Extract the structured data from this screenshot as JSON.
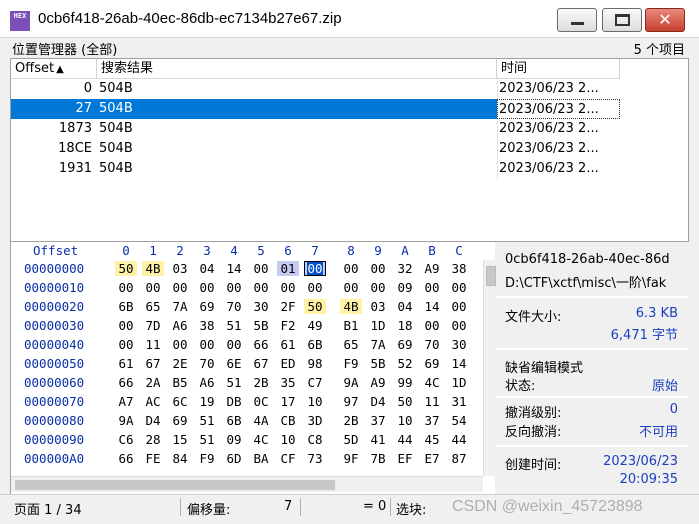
{
  "window": {
    "title": "0cb6f418-26ab-40ec-86db-ec7134b27e67.zip",
    "icon_name": "hex-editor-icon",
    "icon_text": "HEX"
  },
  "location_manager": {
    "title": "位置管理器 (全部)",
    "count": "5 个项目",
    "columns": [
      "Offset",
      "搜索结果",
      "时间"
    ],
    "rows": [
      {
        "offset": "0",
        "result": "504B",
        "time": "2023/06/23   2..."
      },
      {
        "offset": "27",
        "result": "504B",
        "time": "2023/06/23   2...",
        "selected": true
      },
      {
        "offset": "1873",
        "result": "504B",
        "time": "2023/06/23   2..."
      },
      {
        "offset": "18CE",
        "result": "504B",
        "time": "2023/06/23   2..."
      },
      {
        "offset": "1931",
        "result": "504B",
        "time": "2023/06/23   2..."
      }
    ]
  },
  "hex": {
    "offset_label": "Offset",
    "columns": [
      "0",
      "1",
      "2",
      "3",
      "4",
      "5",
      "6",
      "7",
      "8",
      "9",
      "A",
      "B",
      "C"
    ],
    "rows": [
      {
        "offset": "00000000",
        "bytes": [
          "50",
          "4B",
          "03",
          "04",
          "14",
          "00",
          "01",
          "00",
          "00",
          "00",
          "32",
          "A9",
          "38"
        ]
      },
      {
        "offset": "00000010",
        "bytes": [
          "00",
          "00",
          "00",
          "00",
          "00",
          "00",
          "00",
          "00",
          "00",
          "00",
          "09",
          "00",
          "00"
        ]
      },
      {
        "offset": "00000020",
        "bytes": [
          "6B",
          "65",
          "7A",
          "69",
          "70",
          "30",
          "2F",
          "50",
          "4B",
          "03",
          "04",
          "14",
          "00"
        ]
      },
      {
        "offset": "00000030",
        "bytes": [
          "00",
          "7D",
          "A6",
          "38",
          "51",
          "5B",
          "F2",
          "49",
          "B1",
          "1D",
          "18",
          "00",
          "00"
        ]
      },
      {
        "offset": "00000040",
        "bytes": [
          "00",
          "11",
          "00",
          "00",
          "00",
          "66",
          "61",
          "6B",
          "65",
          "7A",
          "69",
          "70",
          "30"
        ]
      },
      {
        "offset": "00000050",
        "bytes": [
          "61",
          "67",
          "2E",
          "70",
          "6E",
          "67",
          "ED",
          "98",
          "F9",
          "5B",
          "52",
          "69",
          "14"
        ]
      },
      {
        "offset": "00000060",
        "bytes": [
          "66",
          "2A",
          "B5",
          "A6",
          "51",
          "2B",
          "35",
          "C7",
          "9A",
          "A9",
          "99",
          "4C",
          "1D"
        ]
      },
      {
        "offset": "00000070",
        "bytes": [
          "A7",
          "AC",
          "6C",
          "19",
          "DB",
          "0C",
          "17",
          "10",
          "97",
          "D4",
          "50",
          "11",
          "31"
        ]
      },
      {
        "offset": "00000080",
        "bytes": [
          "9A",
          "D4",
          "69",
          "51",
          "6B",
          "4A",
          "CB",
          "3D",
          "2B",
          "37",
          "10",
          "37",
          "54"
        ]
      },
      {
        "offset": "00000090",
        "bytes": [
          "C6",
          "28",
          "15",
          "51",
          "09",
          "4C",
          "10",
          "C8",
          "5D",
          "41",
          "44",
          "45",
          "44"
        ]
      },
      {
        "offset": "000000A0",
        "bytes": [
          "66",
          "FE",
          "84",
          "F9",
          "6D",
          "BA",
          "CF",
          "73",
          "9F",
          "7B",
          "EF",
          "E7",
          "87"
        ]
      }
    ]
  },
  "info_panel": {
    "file_name": "0cb6f418-26ab-40ec-86d",
    "file_path": "D:\\CTF\\xctf\\misc\\一阶\\fak",
    "size_label": "文件大小:",
    "size_kb": "6.3 KB",
    "size_bytes": "6,471 字节",
    "mode_title": "缺省编辑模式",
    "state_label": "状态:",
    "state_value": "原始",
    "undo_label": "撤消级别:",
    "undo_value": "0",
    "redo_label": "反向撤消:",
    "redo_value": "不可用",
    "created_label": "创建时间:",
    "created_date": "2023/06/23",
    "created_time": "20:09:35"
  },
  "status_bar": {
    "page": "页面 1 / 34",
    "offset_label": "偏移量:",
    "offset_value": "7",
    "eq": "= 0",
    "select_label": "选块:",
    "watermark": "CSDN @weixin_45723898"
  },
  "colors": {
    "selection": "#0078d7",
    "hex_header": "#0a2fa8",
    "match_highlight": "#fff2a6",
    "info_value": "#1a3fbf"
  }
}
